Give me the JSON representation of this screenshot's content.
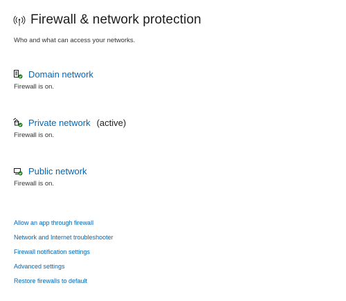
{
  "header": {
    "title": "Firewall & network protection",
    "subtitle": "Who and what can access your networks.",
    "icon": "network-signal-icon"
  },
  "networks": [
    {
      "name": "Domain network",
      "status": "Firewall is on.",
      "active_label": "",
      "icon": "domain-network-icon"
    },
    {
      "name": "Private network",
      "status": "Firewall is on.",
      "active_label": "(active)",
      "icon": "private-network-icon"
    },
    {
      "name": "Public network",
      "status": "Firewall is on.",
      "active_label": "",
      "icon": "public-network-icon"
    }
  ],
  "links": [
    "Allow an app through firewall",
    "Network and Internet troubleshooter",
    "Firewall notification settings",
    "Advanced settings",
    "Restore firewalls to default"
  ],
  "colors": {
    "link": "#0067b8",
    "text": "#1b1b1b",
    "status_ok": "#107c10"
  }
}
